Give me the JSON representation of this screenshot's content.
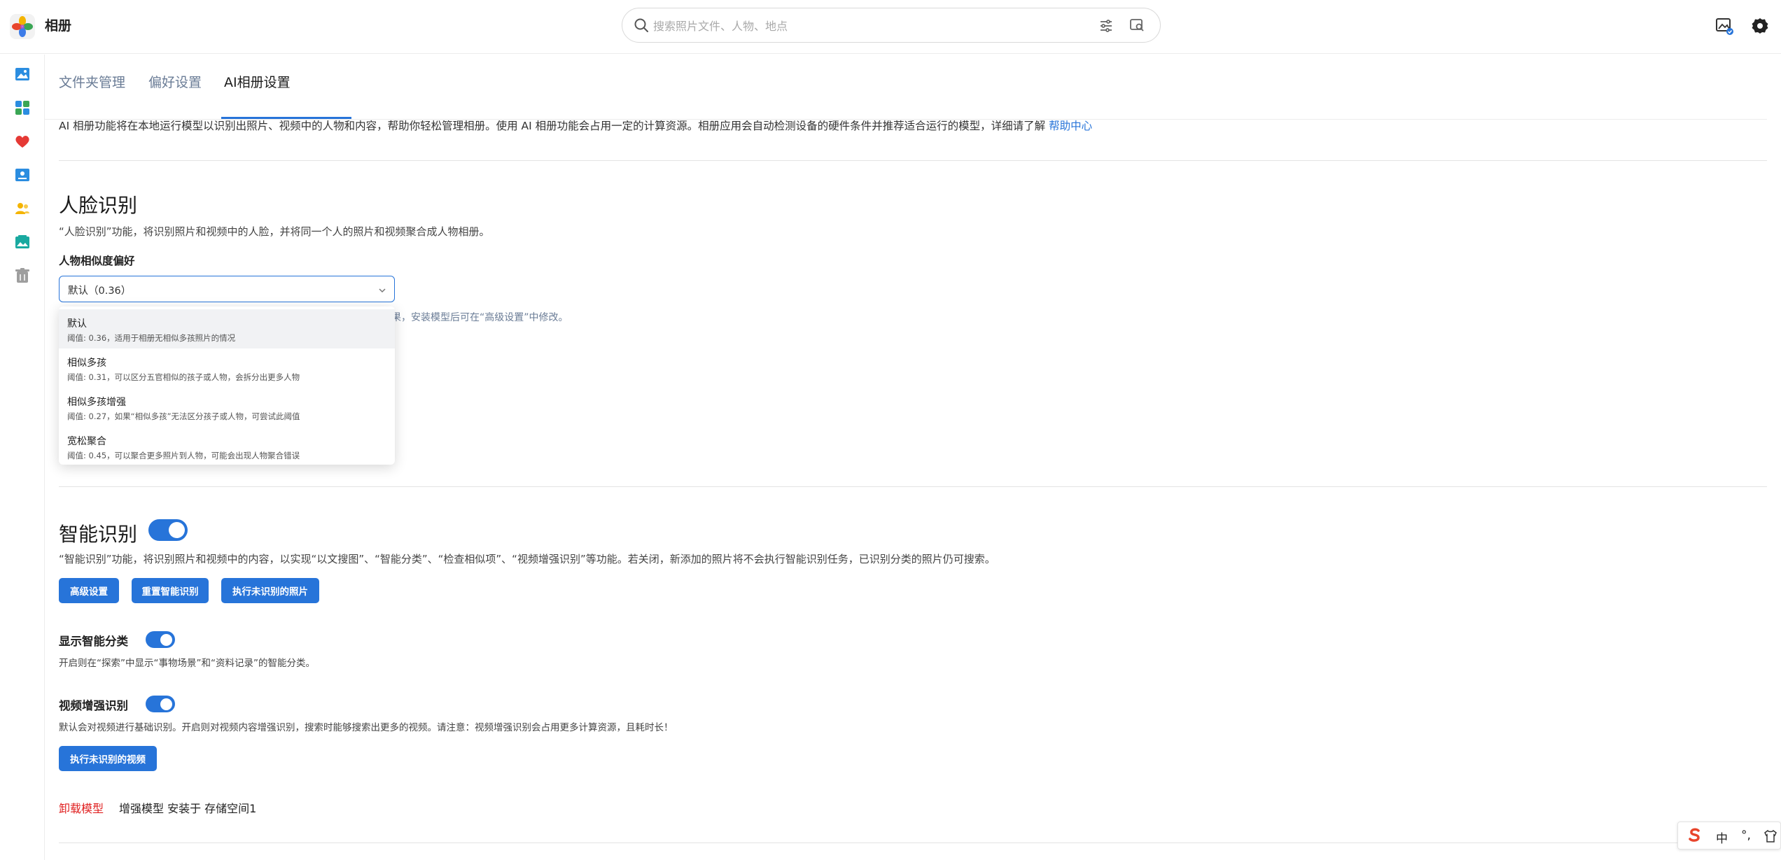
{
  "app": {
    "title": "相册"
  },
  "search": {
    "placeholder": "搜索照片文件、人物、地点"
  },
  "tabs": [
    {
      "label": "文件夹管理"
    },
    {
      "label": "偏好设置"
    },
    {
      "label": "AI相册设置"
    }
  ],
  "intro": {
    "text": "AI 相册功能将在本地运行模型以识别出照片、视频中的人物和内容，帮助你轻松管理相册。使用 AI 相册功能会占用一定的计算资源。相册应用会自动检测设备的硬件条件并推荐适合运行的模型，详细请了解 ",
    "link": "帮助中心"
  },
  "face": {
    "title": "人脸识别",
    "description": "“人脸识别”功能，将识别照片和视频中的人脸，并将同一个人的照片和视频聚合成人物相册。",
    "similarity_label": "人物相似度偏好",
    "selected_value": "默认（0.36）",
    "hint_partial": "果，安装模型后可在“高级设置”中修改。",
    "options": [
      {
        "title": "默认",
        "desc": "阈值: 0.36，适用于相册无相似多孩照片的情况"
      },
      {
        "title": "相似多孩",
        "desc": "阈值: 0.31，可以区分五官相似的孩子或人物，会拆分出更多人物"
      },
      {
        "title": "相似多孩增强",
        "desc": "阈值: 0.27，如果“相似多孩”无法区分孩子或人物，可尝试此阈值"
      },
      {
        "title": "宽松聚合",
        "desc": "阈值: 0.45，可以聚合更多照片到人物，可能会出现人物聚合错误"
      }
    ]
  },
  "smart": {
    "title": "智能识别",
    "enabled": true,
    "description": "“智能识别”功能，将识别照片和视频中的内容，以实现“以文搜图”、“智能分类”、“检查相似项”、“视频增强识别”等功能。若关闭，新添加的照片将不会执行智能识别任务，已识别分类的照片仍可搜索。",
    "buttons": {
      "advanced": "高级设置",
      "reset": "重置智能识别",
      "run_photos": "执行未识别的照片"
    },
    "show_category": {
      "title": "显示智能分类",
      "enabled": true,
      "description": "开启则在“探索”中显示“事物场景”和“资料记录”的智能分类。"
    },
    "video_enhance": {
      "title": "视频增强识别",
      "enabled": true,
      "description": "默认会对视频进行基础识别。开启则对视频内容增强识别，搜索时能够搜索出更多的视频。请注意：视频增强识别会占用更多计算资源，且耗时长！",
      "run_button": "执行未识别的视频"
    },
    "uninstall": "卸载模型",
    "model_info": "增强模型 安装于 存储空间1"
  },
  "ime": {
    "lang": "中",
    "punct": "°,"
  },
  "colors": {
    "accent": "#2774d9",
    "danger": "#e02020"
  }
}
